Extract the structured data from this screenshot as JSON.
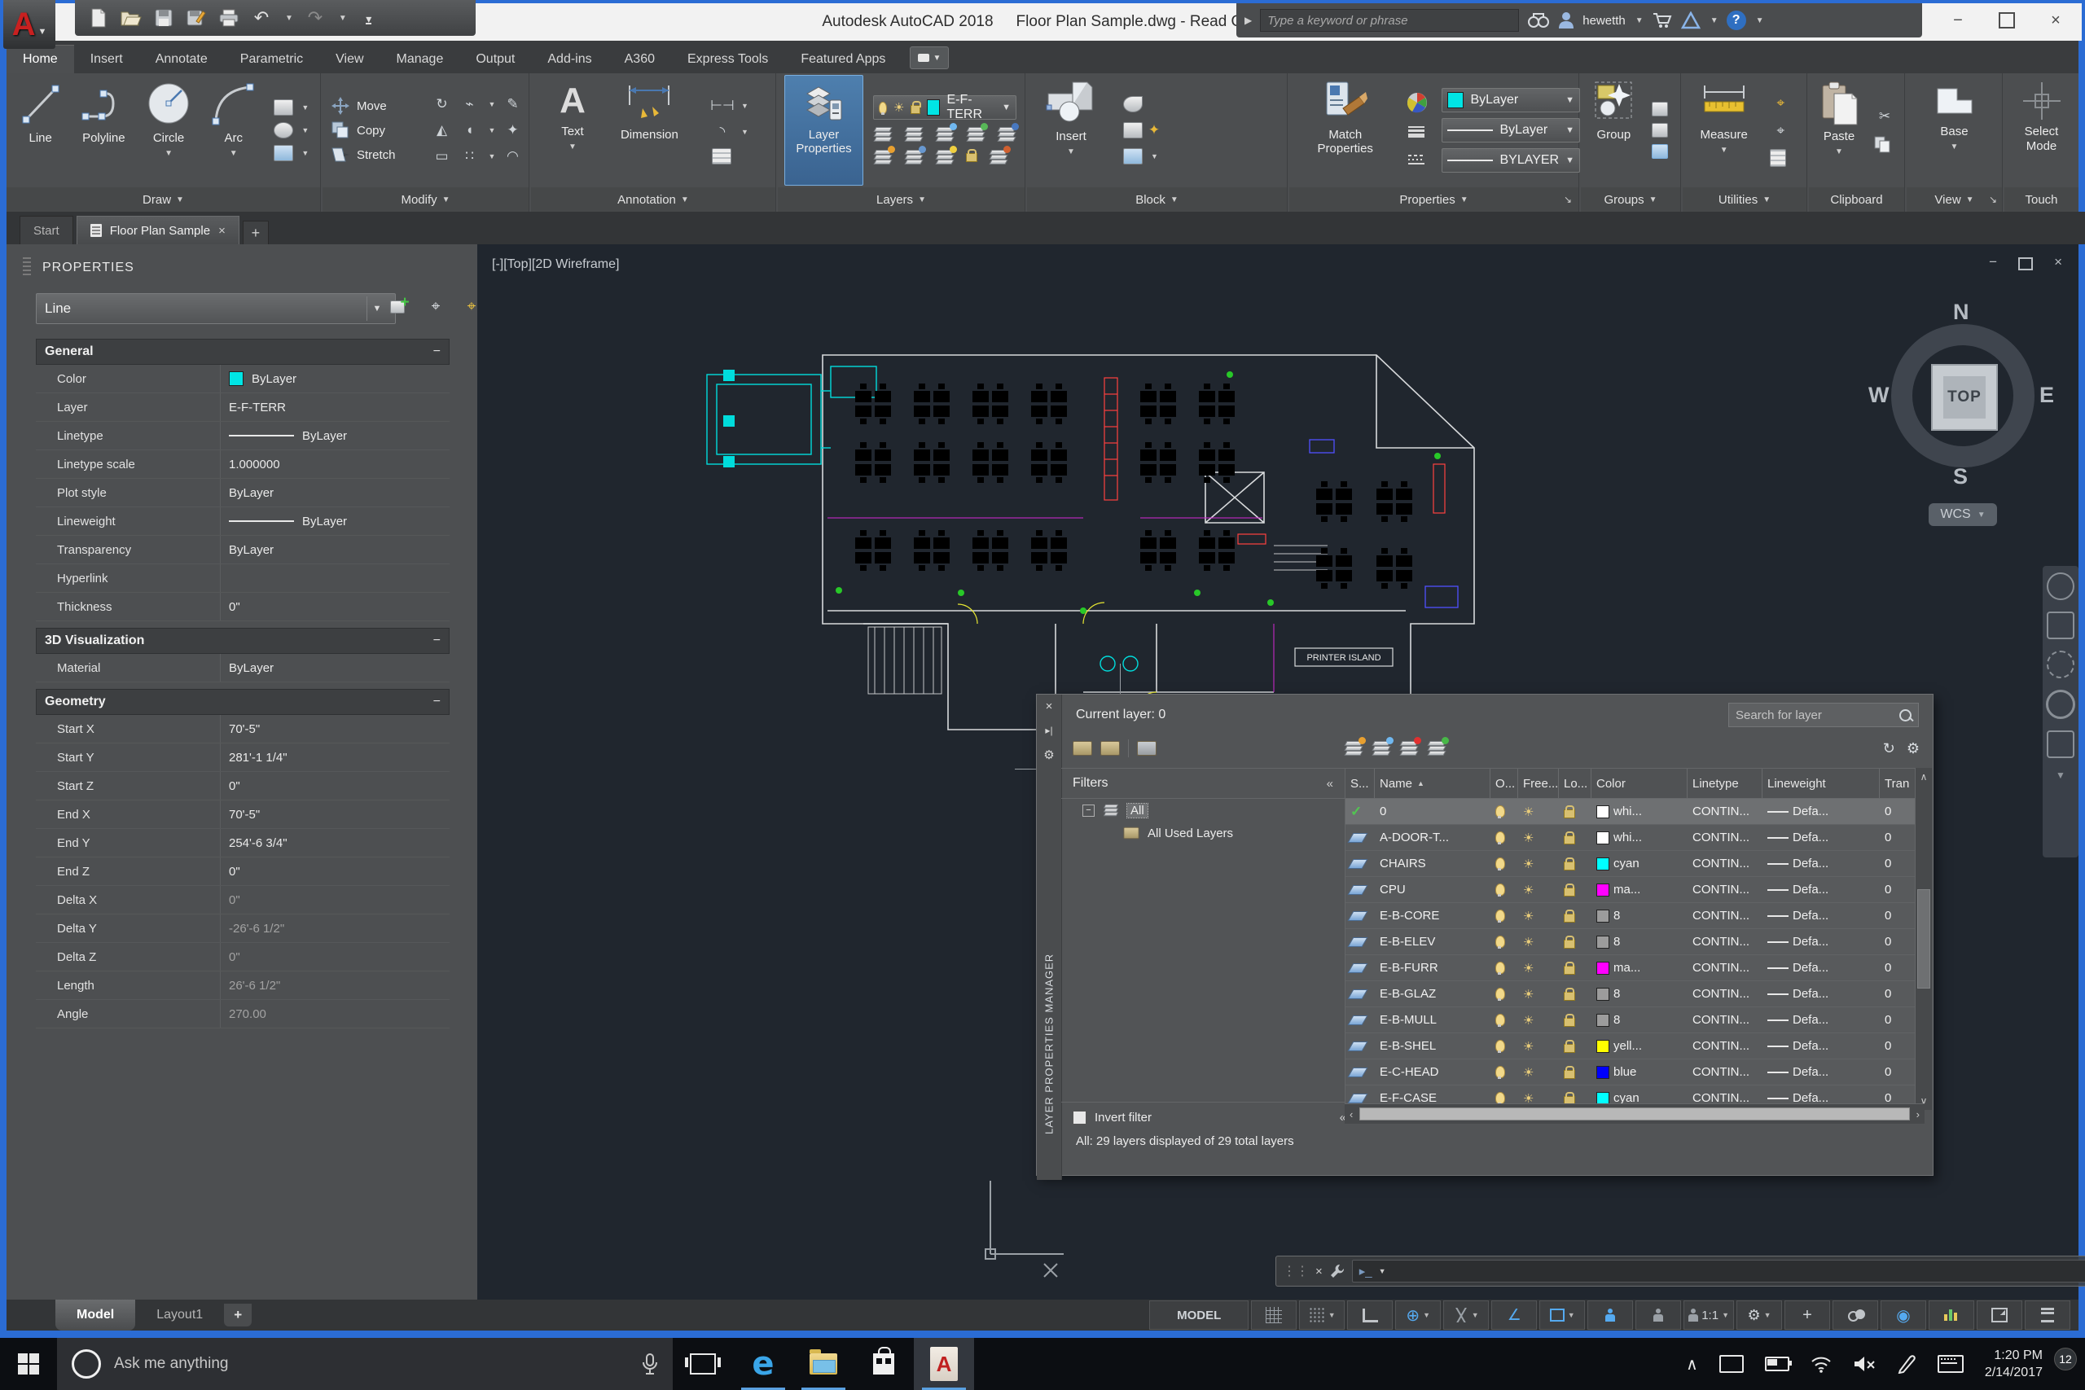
{
  "icons": {
    "dropdown": "▼",
    "dropup": "▲",
    "close": "×",
    "minimize": "−",
    "plus": "+",
    "chevrons": "«",
    "refresh": "↻",
    "gear": "⚙",
    "check": "✓",
    "sun": "☀",
    "home": "⌂",
    "sort_asc": "▲",
    "scroll_up": "∧",
    "scroll_down": "∨",
    "scroll_left": "‹",
    "scroll_right": "›",
    "undo": "↶",
    "redo": "↷",
    "help": "?",
    "tray_up": "∧",
    "angle": "∠",
    "polar": "⊕",
    "circle_dot": "◉",
    "minus": "−",
    "edge_e": "e",
    "acad_a": "A",
    "text_a": "A",
    "scissors": "✂",
    "tree_minus": "−",
    "tree_plus": "+",
    "mic_note": ""
  },
  "window": {
    "title_app": "Autodesk AutoCAD 2018",
    "title_doc": "Floor Plan Sample.dwg - Read Only",
    "search_placeholder": "Type a keyword or phrase",
    "user": "hewetth"
  },
  "ribbon": {
    "active_tab": "Home",
    "tabs": [
      "Home",
      "Insert",
      "Annotate",
      "Parametric",
      "View",
      "Manage",
      "Output",
      "Add-ins",
      "A360",
      "Express Tools",
      "Featured Apps"
    ],
    "panels": {
      "draw": {
        "label": "Draw",
        "buttons": [
          "Line",
          "Polyline",
          "Circle",
          "Arc"
        ]
      },
      "modify": {
        "label": "Modify",
        "buttons": [
          "Move",
          "Copy",
          "Stretch"
        ]
      },
      "annotation": {
        "label": "Annotation",
        "buttons": [
          "Text",
          "Dimension"
        ]
      },
      "layers": {
        "label": "Layers",
        "layer_properties": "Layer Properties",
        "current_layer": "E-F-TERR",
        "swatch": "#00e5e5"
      },
      "block": {
        "label": "Block",
        "insert": "Insert"
      },
      "properties": {
        "label": "Properties",
        "match": "Match Properties",
        "color_value": "ByLayer",
        "color_swatch": "#00e5e5",
        "lineweight_value": "ByLayer",
        "linetype_value": "BYLAYER"
      },
      "groups": {
        "label": "Groups",
        "group": "Group"
      },
      "utilities": {
        "label": "Utilities",
        "measure": "Measure"
      },
      "clipboard": {
        "label": "Clipboard",
        "paste": "Paste"
      },
      "view": {
        "label": "View",
        "base": "Base"
      },
      "touch": {
        "label": "Touch",
        "select_mode": "Select Mode"
      }
    }
  },
  "file_tabs": {
    "start": "Start",
    "doc": "Floor Plan Sample"
  },
  "properties_palette": {
    "title": "PROPERTIES",
    "selector": "Line",
    "sections": [
      {
        "title": "General",
        "rows": [
          {
            "label": "Color",
            "value": "ByLayer",
            "swatch": "#00e5e5"
          },
          {
            "label": "Layer",
            "value": "E-F-TERR"
          },
          {
            "label": "Linetype",
            "value": "ByLayer",
            "line": true
          },
          {
            "label": "Linetype scale",
            "value": "1.000000"
          },
          {
            "label": "Plot style",
            "value": "ByLayer"
          },
          {
            "label": "Lineweight",
            "value": "ByLayer",
            "line": true
          },
          {
            "label": "Transparency",
            "value": "ByLayer"
          },
          {
            "label": "Hyperlink",
            "value": ""
          },
          {
            "label": "Thickness",
            "value": "0\""
          }
        ]
      },
      {
        "title": "3D Visualization",
        "rows": [
          {
            "label": "Material",
            "value": "ByLayer"
          }
        ]
      },
      {
        "title": "Geometry",
        "rows": [
          {
            "label": "Start X",
            "value": "70'-5\""
          },
          {
            "label": "Start Y",
            "value": "281'-1 1/4\""
          },
          {
            "label": "Start Z",
            "value": "0\""
          },
          {
            "label": "End X",
            "value": "70'-5\""
          },
          {
            "label": "End Y",
            "value": "254'-6 3/4\""
          },
          {
            "label": "End Z",
            "value": "0\""
          },
          {
            "label": "Delta X",
            "value": "0\"",
            "muted": true
          },
          {
            "label": "Delta Y",
            "value": "-26'-6 1/2\"",
            "muted": true
          },
          {
            "label": "Delta Z",
            "value": "0\"",
            "muted": true
          },
          {
            "label": "Length",
            "value": "26'-6 1/2\"",
            "muted": true
          },
          {
            "label": "Angle",
            "value": "270.00",
            "muted": true
          }
        ]
      }
    ]
  },
  "viewport": {
    "label": "[-][Top][2D Wireframe]",
    "plan_label": "PRINTER ISLAND",
    "compass": {
      "n": "N",
      "s": "S",
      "e": "E",
      "w": "W",
      "center": "TOP",
      "wcs": "WCS"
    }
  },
  "layer_manager": {
    "title": "LAYER PROPERTIES MANAGER",
    "current": "Current layer: 0",
    "search_placeholder": "Search for layer",
    "filters_label": "Filters",
    "tree_all": "All",
    "tree_used": "All Used Layers",
    "invert_label": "Invert filter",
    "status": "All: 29 layers displayed of 29 total layers",
    "columns": [
      "S...",
      "Name",
      "O...",
      "Free...",
      "Lo...",
      "Color",
      "Linetype",
      "Lineweight",
      "Tran"
    ],
    "linetype": "CONTIN...",
    "lineweight": "Defa...",
    "trans": "0",
    "rows": [
      {
        "name": "0",
        "current": true,
        "color_label": "whi...",
        "color": "#ffffff"
      },
      {
        "name": "A-DOOR-T...",
        "color_label": "whi...",
        "color": "#ffffff"
      },
      {
        "name": "CHAIRS",
        "color_label": "cyan",
        "color": "#00ffff"
      },
      {
        "name": "CPU",
        "color_label": "ma...",
        "color": "#ff00ff"
      },
      {
        "name": "E-B-CORE",
        "color_label": "8",
        "color": "#9c9c9c"
      },
      {
        "name": "E-B-ELEV",
        "color_label": "8",
        "color": "#9c9c9c"
      },
      {
        "name": "E-B-FURR",
        "color_label": "ma...",
        "color": "#ff00ff"
      },
      {
        "name": "E-B-GLAZ",
        "color_label": "8",
        "color": "#9c9c9c"
      },
      {
        "name": "E-B-MULL",
        "color_label": "8",
        "color": "#9c9c9c"
      },
      {
        "name": "E-B-SHEL",
        "color_label": "yell...",
        "color": "#ffff00"
      },
      {
        "name": "E-C-HEAD",
        "color_label": "blue",
        "color": "#0000ff"
      },
      {
        "name": "E-F-CASE",
        "color_label": "cyan",
        "color": "#00ffff"
      }
    ]
  },
  "model_bar": {
    "model": "Model",
    "layout1": "Layout1"
  },
  "status_bar": {
    "model": "MODEL",
    "scale": "1:1"
  },
  "taskbar": {
    "search_placeholder": "Ask me anything",
    "time": "1:20 PM",
    "date": "2/14/2017",
    "badge": "12"
  }
}
